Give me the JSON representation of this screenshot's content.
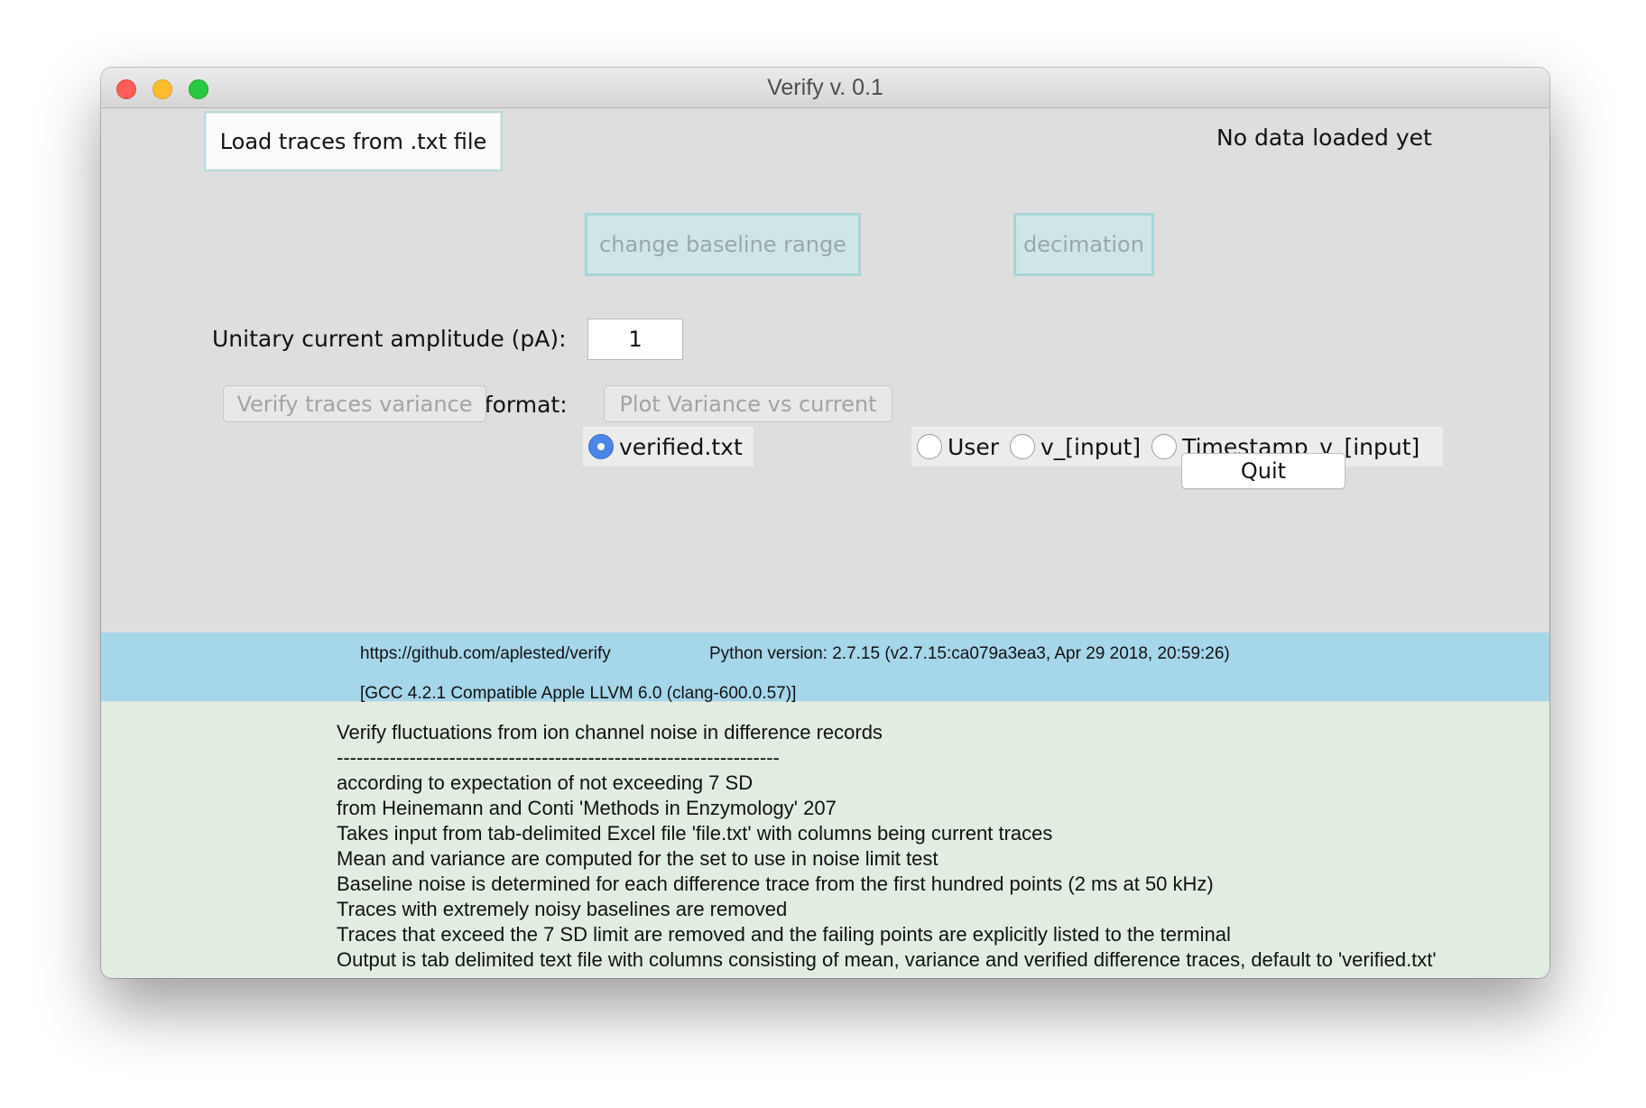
{
  "window": {
    "title": "Verify v. 0.1"
  },
  "controls": {
    "load_button": "Load traces from .txt file",
    "status": "No data loaded yet",
    "baseline_button": "change baseline range",
    "decimation_button": "decimation",
    "amplitude_label": "Unitary current amplitude (pA):",
    "amplitude_value": "1",
    "format_label": "Output file format:",
    "format_options": [
      {
        "label": "verified.txt",
        "selected": true
      },
      {
        "label": "User",
        "selected": false
      },
      {
        "label": "v_[input]",
        "selected": false
      },
      {
        "label": "Timestamp_v_[input]",
        "selected": false
      }
    ],
    "verify_button": "Verify traces variance",
    "plot_button": "Plot Variance vs current",
    "quit_button": "Quit"
  },
  "info": {
    "url": "https://github.com/aplested/verify",
    "python_version": "Python version: 2.7.15 (v2.7.15:ca079a3ea3, Apr 29 2018, 20:59:26)",
    "compiler": "[GCC 4.2.1 Compatible Apple LLVM 6.0 (clang-600.0.57)]"
  },
  "description": {
    "lines": [
      "Verify fluctuations from ion channel noise in difference records",
      "-------------------------------------------------------------------",
      "according to expectation of not exceeding 7 SD",
      "from Heinemann and Conti 'Methods in Enzymology' 207",
      "Takes input from tab-delimited Excel file 'file.txt' with columns being current traces",
      "Mean and variance are computed for the set to use in noise limit test",
      "Baseline noise is determined for each difference trace from the first hundred points (2 ms at 50 kHz)",
      "Traces with extremely noisy baselines are removed",
      "Traces that exceed the 7 SD limit are removed and the failing points are explicitly listed to the terminal",
      "Output is tab delimited text file with columns consisting of mean, variance and verified difference traces, default to 'verified.txt'"
    ]
  },
  "colors": {
    "window_bg": "#dedede",
    "info_bar": "#a6d6ea",
    "description_bg": "#e1ede0",
    "radio_selected": "#4a86e8",
    "teal_button": "#cfe6e7"
  }
}
